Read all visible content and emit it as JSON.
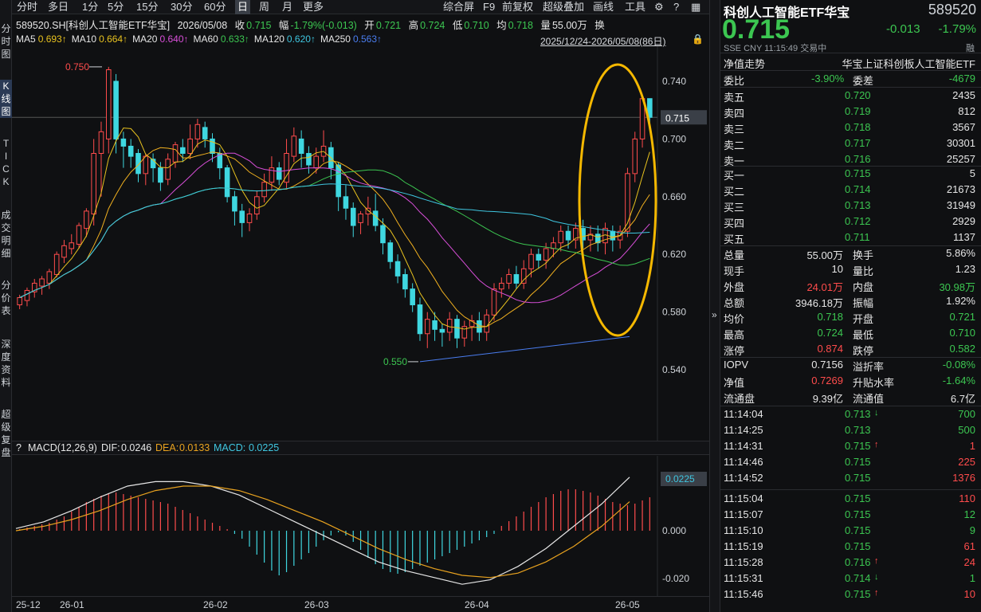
{
  "toolbar": {
    "items": [
      "分时",
      "多日",
      "1分",
      "5分",
      "15分",
      "30分",
      "60分",
      "日",
      "周",
      "月",
      "更多"
    ],
    "active": "日",
    "right": [
      "综合屏",
      "F9",
      "前复权",
      "超级叠加",
      "画线",
      "工具"
    ]
  },
  "left_tabs": [
    {
      "label": "分时图",
      "active": false
    },
    {
      "label": "K线图",
      "active": true
    },
    {
      "label": "TICK",
      "active": false
    },
    {
      "label": "成交明细",
      "active": false
    },
    {
      "label": "分价表",
      "active": false
    },
    {
      "label": "深度资料",
      "active": false
    },
    {
      "label": "超级复盘",
      "active": false
    }
  ],
  "info": {
    "code": "589520.SH[科创人工智能ETF华宝]",
    "date": "2026/05/08",
    "close_label": "收",
    "close": "0.715",
    "change_label": "幅",
    "change": "-1.79%(-0.013)",
    "open_label": "开",
    "open": "0.721",
    "high_label": "高",
    "high": "0.724",
    "low_label": "低",
    "low": "0.710",
    "avg_label": "均",
    "avg": "0.718",
    "vol_label": "量",
    "vol": "55.00万",
    "turn_label": "换"
  },
  "ma": [
    {
      "name": "MA5",
      "value": "0.693↑",
      "color": "#e8c21f"
    },
    {
      "name": "MA10",
      "value": "0.664↑",
      "color": "#e8c21f"
    },
    {
      "name": "MA20",
      "value": "0.640↑",
      "color": "#d94fd9"
    },
    {
      "name": "MA60",
      "value": "0.633↑",
      "color": "#3cc651"
    },
    {
      "name": "MA120",
      "value": "0.620↑",
      "color": "#3fc6e0"
    },
    {
      "name": "MA250",
      "value": "0.563↑",
      "color": "#4a7df0"
    }
  ],
  "range_text": "2025/12/24-2026/05/08(86日)",
  "price_axis": [
    "0.740",
    "0.700",
    "0.660",
    "0.620",
    "0.580",
    "0.540"
  ],
  "current_price_tag": "0.715",
  "markers": {
    "high": "0.750",
    "low": "0.550"
  },
  "macd": {
    "title": "MACD(12,26,9)",
    "dif_label": "DIF:",
    "dif": "0.0246",
    "dea_label": "DEA:",
    "dea": "0.0133",
    "macd_label": "MACD:",
    "macd": "0.0225",
    "axis": [
      "0.000",
      "-0.020"
    ],
    "tag": "0.0225"
  },
  "xaxis": [
    "25-12",
    "26-01",
    "26-02",
    "26-03",
    "26-04",
    "26-05"
  ],
  "header": {
    "name": "科创人工智能ETF华宝",
    "code": "589520",
    "price": "0.715",
    "change": "-0.013",
    "pct": "-1.79%",
    "meta": "SSE  CNY  11:15:49  交易中",
    "rong": "融",
    "nav_label": "净值走势",
    "index_name": "华宝上证科创板人工智能ETF"
  },
  "ratio": {
    "wb_label": "委比",
    "wb": "-3.90%",
    "wc_label": "委差",
    "wc": "-4679"
  },
  "asks": [
    {
      "label": "卖五",
      "price": "0.720",
      "vol": "2435"
    },
    {
      "label": "卖四",
      "price": "0.719",
      "vol": "812"
    },
    {
      "label": "卖三",
      "price": "0.718",
      "vol": "3567"
    },
    {
      "label": "卖二",
      "price": "0.717",
      "vol": "30301"
    },
    {
      "label": "卖一",
      "price": "0.716",
      "vol": "25257"
    }
  ],
  "bids": [
    {
      "label": "买一",
      "price": "0.715",
      "vol": "5"
    },
    {
      "label": "买二",
      "price": "0.714",
      "vol": "21673"
    },
    {
      "label": "买三",
      "price": "0.713",
      "vol": "31949"
    },
    {
      "label": "买四",
      "price": "0.712",
      "vol": "2929"
    },
    {
      "label": "买五",
      "price": "0.711",
      "vol": "1137"
    }
  ],
  "stats": [
    [
      {
        "l": "总量",
        "v": "55.00万",
        "c": "white"
      },
      {
        "l": "换手",
        "v": "5.86%",
        "c": "white"
      }
    ],
    [
      {
        "l": "现手",
        "v": "10",
        "c": "white"
      },
      {
        "l": "量比",
        "v": "1.23",
        "c": "white"
      }
    ],
    [
      {
        "l": "外盘",
        "v": "24.01万",
        "c": "red"
      },
      {
        "l": "内盘",
        "v": "30.98万",
        "c": "green"
      }
    ],
    [
      {
        "l": "总额",
        "v": "3946.18万",
        "c": "white"
      },
      {
        "l": "振幅",
        "v": "1.92%",
        "c": "white"
      }
    ],
    [
      {
        "l": "均价",
        "v": "0.718",
        "c": "green"
      },
      {
        "l": "开盘",
        "v": "0.721",
        "c": "green"
      }
    ],
    [
      {
        "l": "最高",
        "v": "0.724",
        "c": "green"
      },
      {
        "l": "最低",
        "v": "0.710",
        "c": "green"
      }
    ],
    [
      {
        "l": "涨停",
        "v": "0.874",
        "c": "red"
      },
      {
        "l": "跌停",
        "v": "0.582",
        "c": "green"
      }
    ]
  ],
  "iopv": [
    [
      {
        "l": "IOPV",
        "v": "0.7156",
        "c": "white"
      },
      {
        "l": "溢折率",
        "v": "-0.08%",
        "c": "green"
      }
    ],
    [
      {
        "l": "净值",
        "v": "0.7269",
        "c": "red"
      },
      {
        "l": "升贴水率",
        "v": "-1.64%",
        "c": "green"
      }
    ],
    [
      {
        "l": "流通盘",
        "v": "9.39亿",
        "c": "white"
      },
      {
        "l": "流通值",
        "v": "6.7亿",
        "c": "white"
      }
    ]
  ],
  "ticks": [
    {
      "t": "11:14:04",
      "p": "0.713",
      "a": "↓",
      "v": "700",
      "vc": "green"
    },
    {
      "t": "11:14:25",
      "p": "0.713",
      "a": "",
      "v": "500",
      "vc": "green"
    },
    {
      "t": "11:14:31",
      "p": "0.715",
      "a": "↑",
      "v": "1",
      "vc": "red"
    },
    {
      "t": "11:14:46",
      "p": "0.715",
      "a": "",
      "v": "225",
      "vc": "red"
    },
    {
      "t": "11:14:52",
      "p": "0.715",
      "a": "",
      "v": "1376",
      "vc": "red"
    },
    {
      "t": "11:15:04",
      "p": "0.715",
      "a": "",
      "v": "110",
      "vc": "red"
    },
    {
      "t": "11:15:07",
      "p": "0.715",
      "a": "",
      "v": "12",
      "vc": "green"
    },
    {
      "t": "11:15:10",
      "p": "0.715",
      "a": "",
      "v": "9",
      "vc": "green"
    },
    {
      "t": "11:15:19",
      "p": "0.715",
      "a": "",
      "v": "61",
      "vc": "red"
    },
    {
      "t": "11:15:28",
      "p": "0.716",
      "a": "↑",
      "v": "24",
      "vc": "red"
    },
    {
      "t": "11:15:31",
      "p": "0.714",
      "a": "↓",
      "v": "1",
      "vc": "green"
    },
    {
      "t": "11:15:46",
      "p": "0.715",
      "a": "↑",
      "v": "10",
      "vc": "red"
    }
  ]
}
